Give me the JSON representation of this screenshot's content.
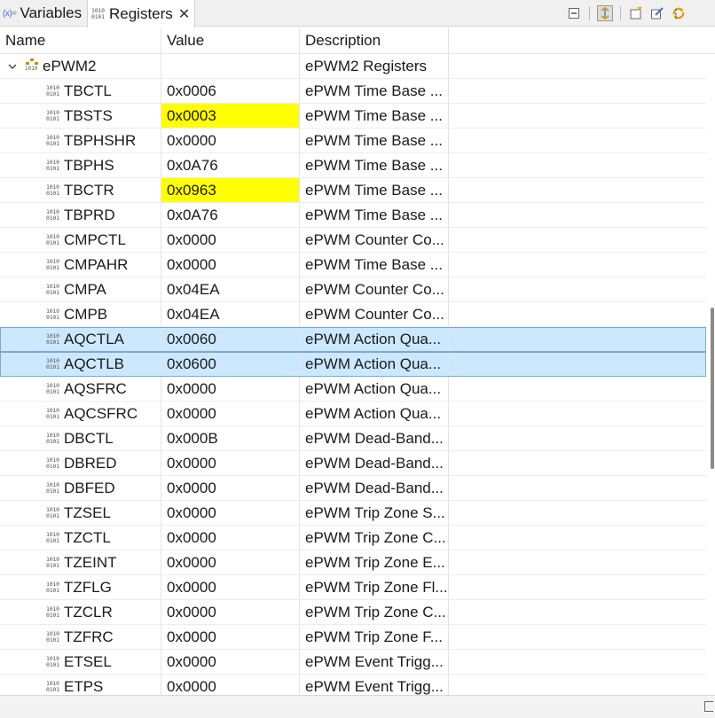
{
  "tabs": [
    {
      "label": "Variables",
      "icon": "variables-icon",
      "icon_text": "(x)="
    },
    {
      "label": "Registers",
      "icon": "binary-icon",
      "active": true
    }
  ],
  "bin_glyph": {
    "top": "1010",
    "bottom": "0101"
  },
  "toolbar": {
    "buttons": [
      "collapse-all-icon",
      "sync-icon",
      "new-group-icon",
      "edit-icon",
      "refresh-icon"
    ],
    "more": "⋮"
  },
  "columns": {
    "name": "Name",
    "value": "Value",
    "description": "Description"
  },
  "group": {
    "name": "ePWM2",
    "value": "",
    "description": "ePWM2 Registers",
    "expanded": true
  },
  "registers": [
    {
      "name": "TBCTL",
      "value": "0x0006",
      "description": "ePWM Time Base ...",
      "changed": false,
      "selected": false
    },
    {
      "name": "TBSTS",
      "value": "0x0003",
      "description": "ePWM Time Base ...",
      "changed": true,
      "selected": false
    },
    {
      "name": "TBPHSHR",
      "value": "0x0000",
      "description": "ePWM Time Base ...",
      "changed": false,
      "selected": false
    },
    {
      "name": "TBPHS",
      "value": "0x0A76",
      "description": "ePWM Time Base ...",
      "changed": false,
      "selected": false
    },
    {
      "name": "TBCTR",
      "value": "0x0963",
      "description": "ePWM Time Base ...",
      "changed": true,
      "selected": false
    },
    {
      "name": "TBPRD",
      "value": "0x0A76",
      "description": "ePWM Time Base ...",
      "changed": false,
      "selected": false
    },
    {
      "name": "CMPCTL",
      "value": "0x0000",
      "description": "ePWM Counter Co...",
      "changed": false,
      "selected": false
    },
    {
      "name": "CMPAHR",
      "value": "0x0000",
      "description": "ePWM Time Base ...",
      "changed": false,
      "selected": false
    },
    {
      "name": "CMPA",
      "value": "0x04EA",
      "description": "ePWM Counter Co...",
      "changed": false,
      "selected": false
    },
    {
      "name": "CMPB",
      "value": "0x04EA",
      "description": "ePWM Counter Co...",
      "changed": false,
      "selected": false
    },
    {
      "name": "AQCTLA",
      "value": "0x0060",
      "description": "ePWM Action Qua...",
      "changed": false,
      "selected": true
    },
    {
      "name": "AQCTLB",
      "value": "0x0600",
      "description": "ePWM Action Qua...",
      "changed": false,
      "selected": true
    },
    {
      "name": "AQSFRC",
      "value": "0x0000",
      "description": "ePWM Action Qua...",
      "changed": false,
      "selected": false
    },
    {
      "name": "AQCSFRC",
      "value": "0x0000",
      "description": "ePWM Action Qua...",
      "changed": false,
      "selected": false
    },
    {
      "name": "DBCTL",
      "value": "0x000B",
      "description": "ePWM Dead-Band...",
      "changed": false,
      "selected": false
    },
    {
      "name": "DBRED",
      "value": "0x0000",
      "description": "ePWM Dead-Band...",
      "changed": false,
      "selected": false
    },
    {
      "name": "DBFED",
      "value": "0x0000",
      "description": "ePWM Dead-Band...",
      "changed": false,
      "selected": false
    },
    {
      "name": "TZSEL",
      "value": "0x0000",
      "description": "ePWM Trip Zone S...",
      "changed": false,
      "selected": false
    },
    {
      "name": "TZCTL",
      "value": "0x0000",
      "description": "ePWM Trip Zone C...",
      "changed": false,
      "selected": false
    },
    {
      "name": "TZEINT",
      "value": "0x0000",
      "description": "ePWM Trip Zone E...",
      "changed": false,
      "selected": false
    },
    {
      "name": "TZFLG",
      "value": "0x0000",
      "description": "ePWM Trip Zone Fl...",
      "changed": false,
      "selected": false
    },
    {
      "name": "TZCLR",
      "value": "0x0000",
      "description": "ePWM Trip Zone C...",
      "changed": false,
      "selected": false
    },
    {
      "name": "TZFRC",
      "value": "0x0000",
      "description": "ePWM Trip Zone F...",
      "changed": false,
      "selected": false
    },
    {
      "name": "ETSEL",
      "value": "0x0000",
      "description": "ePWM Event Trigg...",
      "changed": false,
      "selected": false
    },
    {
      "name": "ETPS",
      "value": "0x0000",
      "description": "ePWM Event Trigg...",
      "changed": false,
      "selected": false
    }
  ],
  "colors": {
    "changed_highlight": "#ffff00",
    "selection": "#cce8ff",
    "selection_border": "#7aa8d8"
  }
}
